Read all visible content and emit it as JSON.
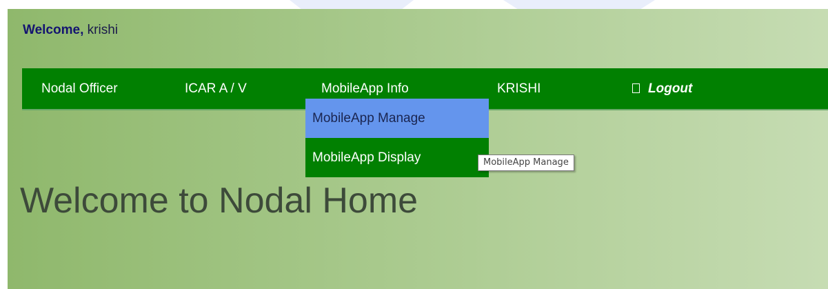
{
  "header": {
    "welcome_label": "Welcome,",
    "username": "krishi"
  },
  "nav": {
    "items": [
      {
        "label": "Nodal Officer"
      },
      {
        "label": "ICAR A / V"
      },
      {
        "label": "MobileApp Info"
      },
      {
        "label": "KRISHI"
      },
      {
        "label": "Logout",
        "icon": "box-icon"
      }
    ]
  },
  "dropdown": {
    "items": [
      {
        "label": "MobileApp Manage",
        "state": "hover"
      },
      {
        "label": "MobileApp Display"
      }
    ]
  },
  "tooltip": {
    "text": "MobileApp Manage"
  },
  "main": {
    "heading": "Welcome to Nodal Home"
  },
  "colors": {
    "navbar": "#018001",
    "dropdown_hover": "#6495ed",
    "background_start": "#8fb86c",
    "background_end": "#c6dcb3"
  }
}
